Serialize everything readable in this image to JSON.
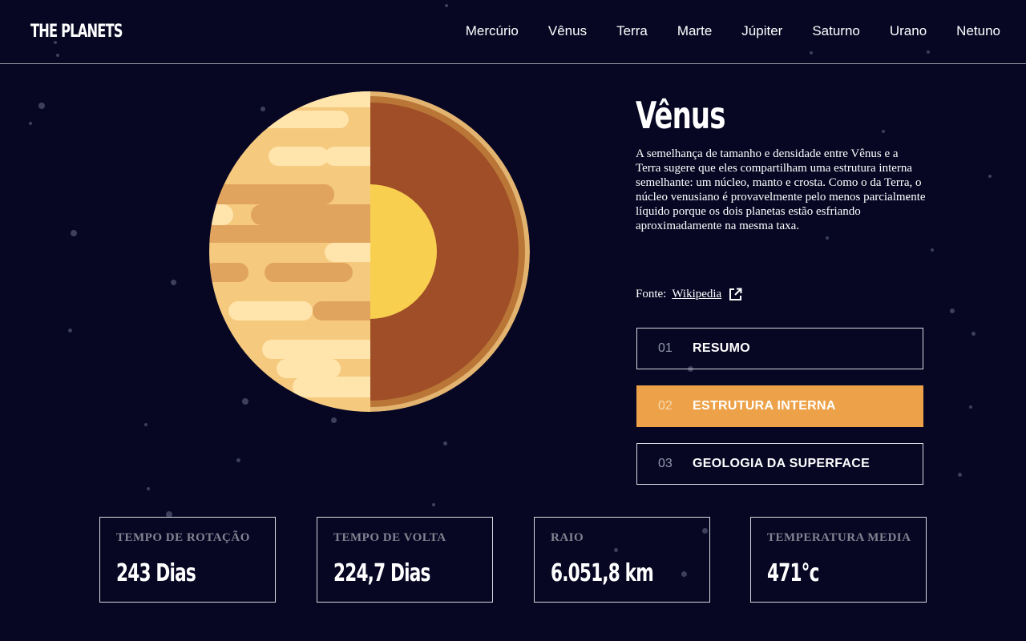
{
  "header": {
    "logo": "THE PLANETS",
    "nav": [
      "Mercúrio",
      "Vênus",
      "Terra",
      "Marte",
      "Júpiter",
      "Saturno",
      "Urano",
      "Netuno"
    ]
  },
  "planet": {
    "name": "Vênus",
    "description": "A semelhança de tamanho e densidade entre Vênus e a Terra sugere que eles compartilham uma estrutura interna semelhante: um núcleo, manto e crosta. Como o da Terra, o núcleo venusiano é provavelmente pelo menos parcialmente líquido porque os dois planetas estão esfriando aproximadamente na mesma taxa.",
    "source_label": "Fonte:",
    "source_link": "Wikipedia",
    "source_icon": "external-link-icon"
  },
  "tabs": [
    {
      "num": "01",
      "label": "RESUMO",
      "active": false
    },
    {
      "num": "02",
      "label": "ESTRUTURA INTERNA",
      "active": true
    },
    {
      "num": "03",
      "label": "GEOLOGIA DA SUPERFACE",
      "active": false
    }
  ],
  "stats": [
    {
      "label": "TEMPO DE ROTAÇÃO",
      "value": "243 Dias"
    },
    {
      "label": "TEMPO DE VOLTA",
      "value": "224,7 Dias"
    },
    {
      "label": "RAIO",
      "value": "6.051,8 km"
    },
    {
      "label": "TEMPERATURA MEDIA",
      "value": "471°c"
    }
  ],
  "colors": {
    "background": "#070724",
    "accent": "#EDA249",
    "border": "#d8d8de",
    "muted": "#838391"
  }
}
